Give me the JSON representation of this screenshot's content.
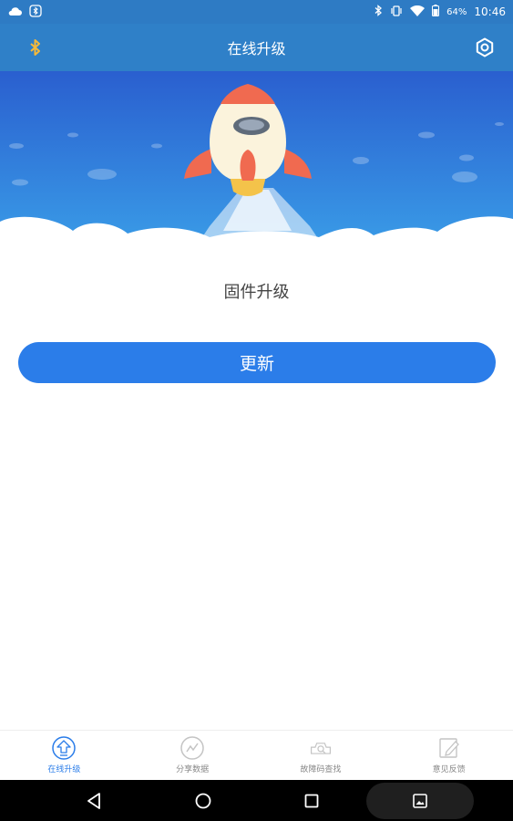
{
  "status_bar": {
    "battery_percent": "64%",
    "time": "10:46",
    "icons": [
      "cloud-icon",
      "bluetooth-notification-icon",
      "bluetooth-icon",
      "vibrate-icon",
      "wifi-icon",
      "battery-icon"
    ]
  },
  "app_bar": {
    "title": "在线升级",
    "left_icon": "bluetooth-icon",
    "right_icon": "settings-gear-icon"
  },
  "main": {
    "firmware_label": "固件升级",
    "update_button_label": "更新"
  },
  "tabs": [
    {
      "label": "在线升级",
      "icon": "upgrade-icon",
      "active": true
    },
    {
      "label": "分享数据",
      "icon": "share-data-icon",
      "active": false
    },
    {
      "label": "故障码查找",
      "icon": "fault-code-icon",
      "active": false
    },
    {
      "label": "意见反馈",
      "icon": "feedback-icon",
      "active": false
    }
  ],
  "colors": {
    "status_bar": "#2e7bc4",
    "app_bar": "#2f80c8",
    "accent": "#2b7de9",
    "bluetooth_icon": "#f5b93a",
    "rocket_red": "#f06a50"
  }
}
